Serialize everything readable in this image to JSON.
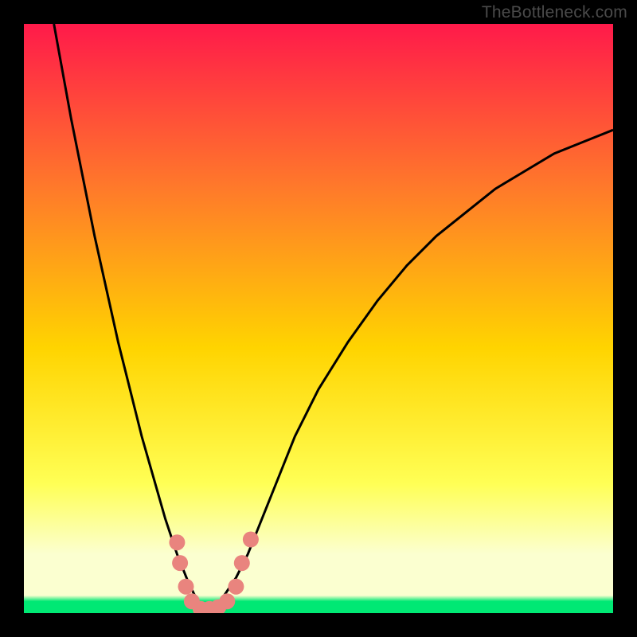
{
  "watermark": "TheBottleneck.com",
  "colors": {
    "top": "#ff1a4a",
    "mid_upper": "#ff7a2a",
    "mid": "#ffd400",
    "mid_lower": "#ffff55",
    "pale": "#fbffd0",
    "green": "#00e874",
    "curve": "#000000",
    "marker": "#e9847e"
  },
  "chart_data": {
    "type": "line",
    "title": "",
    "xlabel": "",
    "ylabel": "",
    "xlim": [
      0,
      100
    ],
    "ylim": [
      0,
      100
    ],
    "x": [
      0,
      2,
      4,
      6,
      8,
      10,
      12,
      14,
      16,
      18,
      20,
      22,
      24,
      26,
      28,
      29,
      30,
      31,
      32,
      33,
      34,
      36,
      38,
      40,
      42,
      44,
      46,
      48,
      50,
      55,
      60,
      65,
      70,
      75,
      80,
      85,
      90,
      95,
      100
    ],
    "series": [
      {
        "name": "bottleneck-curve",
        "values": [
          130,
          118,
          106,
          95,
          84,
          74,
          64,
          55,
          46,
          38,
          30,
          23,
          16,
          10,
          5,
          3,
          1,
          0,
          0,
          1,
          3,
          6,
          10,
          15,
          20,
          25,
          30,
          34,
          38,
          46,
          53,
          59,
          64,
          68,
          72,
          75,
          78,
          80,
          82
        ]
      }
    ],
    "markers": [
      {
        "x": 26.0,
        "y": 12.0
      },
      {
        "x": 26.5,
        "y": 8.5
      },
      {
        "x": 27.5,
        "y": 4.5
      },
      {
        "x": 28.5,
        "y": 2.0
      },
      {
        "x": 30.0,
        "y": 0.7
      },
      {
        "x": 31.5,
        "y": 0.7
      },
      {
        "x": 33.0,
        "y": 1.0
      },
      {
        "x": 34.5,
        "y": 2.0
      },
      {
        "x": 36.0,
        "y": 4.5
      },
      {
        "x": 37.0,
        "y": 8.5
      },
      {
        "x": 38.5,
        "y": 12.5
      }
    ]
  }
}
